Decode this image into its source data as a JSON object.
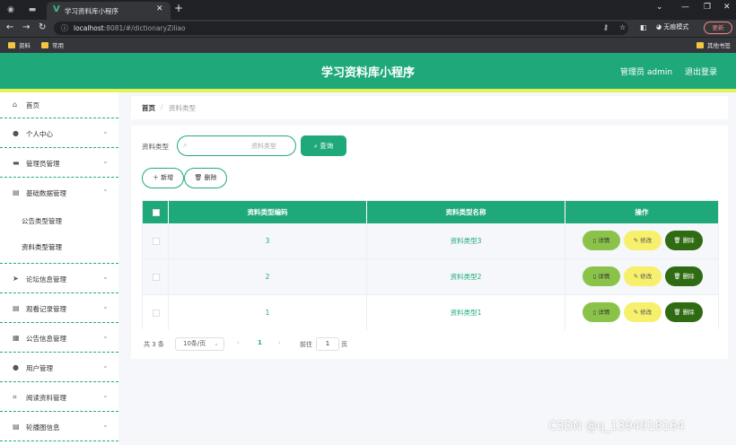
{
  "browser": {
    "tab_title": "学习资料库小程序",
    "url_host": "localhost",
    "url_rest": ":8081/#/dictionaryZiliao",
    "incognito_label": "无痕模式",
    "update_label": "更新",
    "bookmarks": [
      "资料",
      "常用"
    ],
    "other_bookmarks": "其他书签"
  },
  "header": {
    "title": "学习资料库小程序",
    "user": "管理员 admin",
    "logout": "退出登录"
  },
  "sidebar": {
    "items": [
      {
        "label": "首页",
        "icon": "home-icon"
      },
      {
        "label": "个人中心",
        "icon": "user-icon"
      },
      {
        "label": "管理员管理",
        "icon": "monitor-icon"
      },
      {
        "label": "基础数据管理",
        "icon": "clipboard-icon"
      },
      {
        "label": "论坛信息管理",
        "icon": "send-icon"
      },
      {
        "label": "观看记录管理",
        "icon": "clipboard-icon"
      },
      {
        "label": "公告信息管理",
        "icon": "grid-icon"
      },
      {
        "label": "用户管理",
        "icon": "user-icon"
      },
      {
        "label": "阅读资料管理",
        "icon": "crop-icon"
      },
      {
        "label": "轮播图信息",
        "icon": "clipboard-icon"
      }
    ],
    "sub_items": [
      "公告类型管理",
      "资料类型管理"
    ]
  },
  "breadcrumb": {
    "home": "首页",
    "sep": "/",
    "current": "资料类型"
  },
  "filter": {
    "label": "资料类型",
    "placeholder": "资料类型",
    "query_button": "查询"
  },
  "actions": {
    "add": "新增",
    "delete": "删除"
  },
  "table": {
    "headers": [
      "资料类型编码",
      "资料类型名称",
      "操作"
    ],
    "rows": [
      {
        "code": "3",
        "name": "资料类型3"
      },
      {
        "code": "2",
        "name": "资料类型2"
      },
      {
        "code": "1",
        "name": "资料类型1"
      }
    ],
    "row_actions": {
      "detail": "详情",
      "edit": "修改",
      "delete": "删除"
    }
  },
  "pager": {
    "total": "共 3 条",
    "page_size": "10条/页",
    "current_page": "1",
    "goto_label": "前往",
    "goto_value": "1",
    "page_suffix": "页"
  },
  "watermark": "CSDN @q_1394918164",
  "colors": {
    "primary": "#1fa97a",
    "accent_line": "#e5f25a",
    "edit": "#f6f06d",
    "detail": "#8bc34a",
    "delete": "#2f6b12"
  }
}
